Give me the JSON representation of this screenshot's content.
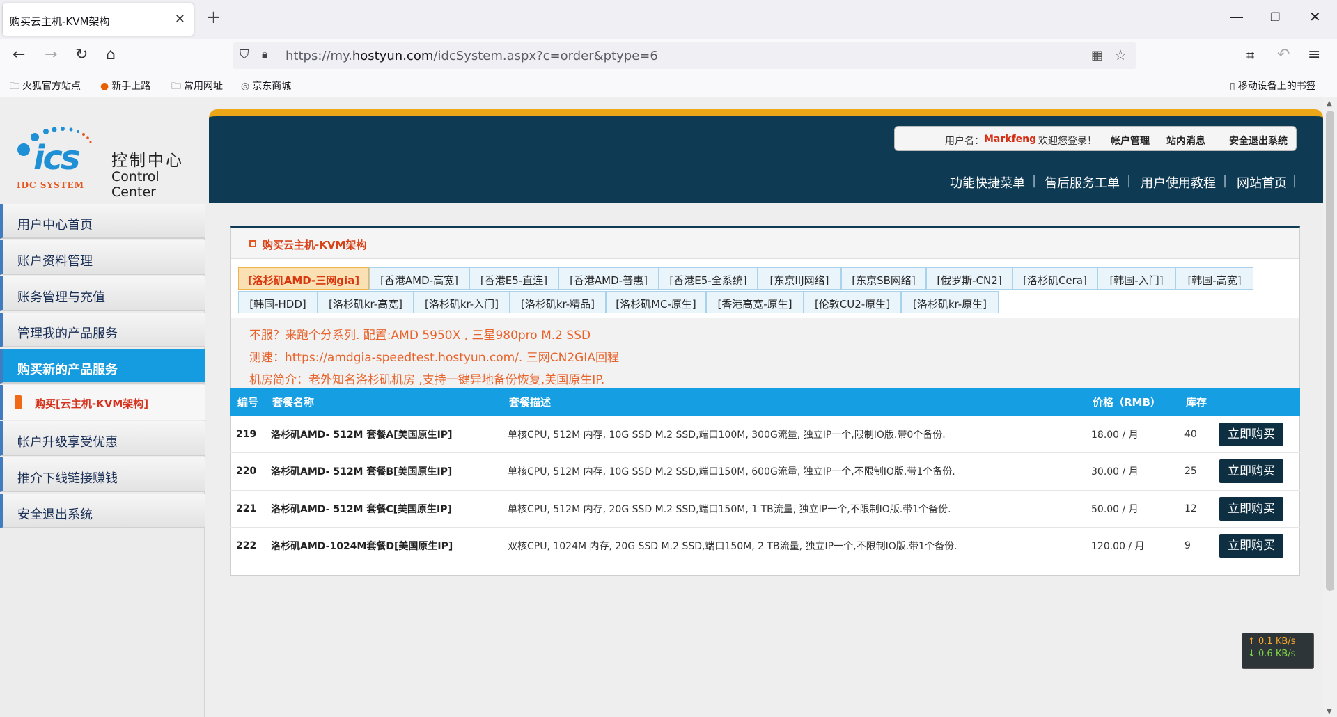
{
  "browser": {
    "tab_title": "购买云主机-KVM架构",
    "url_prefix": "https://my.",
    "url_domain": "hostyun.com",
    "url_path": "/idcSystem.aspx?c=order&ptype=6",
    "bookmarks": [
      "火狐官方站点",
      "新手上路",
      "常用网址",
      "京东商城"
    ],
    "mobile_bookmarks": "移动设备上的书签"
  },
  "logo": {
    "mark": "ics",
    "sub": "IDC SYSTEM",
    "cn": "控制中心",
    "en": "Control Center"
  },
  "userbar": {
    "label": "用户名：",
    "username": "Markfeng",
    "welcome": "欢迎您登录！",
    "links": [
      "帐户管理",
      "站内消息",
      "安全退出系统"
    ]
  },
  "topmenu": [
    "功能快捷菜单",
    "售后服务工单",
    "用户使用教程",
    "网站首页"
  ],
  "sidebar": {
    "items": [
      "用户中心首页",
      "账户资料管理",
      "账务管理与充值",
      "管理我的产品服务",
      "购买新的产品服务",
      "帐户升级享受优惠",
      "推介下线链接赚钱",
      "安全退出系统"
    ],
    "sub_item": "购买[云主机-KVM架构]"
  },
  "panel": {
    "title": "购买云主机-KVM架构",
    "tabs_row1": [
      "[洛杉矶AMD-三网gia]",
      "[香港AMD-高宽]",
      "[香港E5-直连]",
      "[香港AMD-普惠]",
      "[香港E5-全系统]",
      "[东京IIJ网络]",
      "[东京SB网络]",
      "[俄罗斯-CN2]",
      "[洛杉矶Cera]",
      "[韩国-入门]",
      "[韩国-高宽]"
    ],
    "tabs_row2": [
      "[韩国-HDD]",
      "[洛杉矶kr-高宽]",
      "[洛杉矶kr-入门]",
      "[洛杉矶kr-精品]",
      "[洛杉矶MC-原生]",
      "[香港高宽-原生]",
      "[伦敦CU2-原生]",
      "[洛杉矶kr-原生]"
    ],
    "notice": [
      "不服？来跑个分系列. 配置:AMD 5950X , 三星980pro M.2 SSD",
      "测速：https://amdgia-speedtest.hostyun.com/. 三网CN2GIA回程",
      "机房简介：老外知名洛杉矶机房 ,支持一键异地备份恢复,美国原生IP."
    ]
  },
  "table": {
    "headers": [
      "编号",
      "套餐名称",
      "套餐描述",
      "价格（RMB）",
      "库存",
      ""
    ],
    "buy_label": "立即购买",
    "rows": [
      {
        "id": "219",
        "name": "洛杉矶AMD- 512M 套餐A[美国原生IP]",
        "desc": "单核CPU, 512M 内存, 10G SSD M.2 SSD,端口100M, 300G流量, 独立IP一个,限制IO版.带0个备份.",
        "price": "18.00 / 月",
        "stock": "40"
      },
      {
        "id": "220",
        "name": "洛杉矶AMD- 512M 套餐B[美国原生IP]",
        "desc": "单核CPU, 512M 内存, 10G SSD M.2 SSD,端口150M, 600G流量, 独立IP一个,不限制IO版.带1个备份.",
        "price": "30.00 / 月",
        "stock": "25"
      },
      {
        "id": "221",
        "name": "洛杉矶AMD- 512M 套餐C[美国原生IP]",
        "desc": "单核CPU, 512M 内存, 20G SSD M.2 SSD,端口150M, 1 TB流量, 独立IP一个,不限制IO版.带1个备份.",
        "price": "50.00 / 月",
        "stock": "12"
      },
      {
        "id": "222",
        "name": "洛杉矶AMD-1024M套餐D[美国原生IP]",
        "desc": "双核CPU, 1024M 内存, 20G SSD M.2 SSD,端口150M, 2 TB流量, 独立IP一个,不限制IO版.带1个备份.",
        "price": "120.00 / 月",
        "stock": "9"
      }
    ]
  },
  "speed": {
    "up": "↑ 0.1 KB/s",
    "down": "↓ 0.6 KB/s"
  },
  "colors": {
    "header_bg": "#0e3a54",
    "accent_orange": "#eba718",
    "table_header": "#169ee3",
    "active_nav": "#159ce0"
  }
}
